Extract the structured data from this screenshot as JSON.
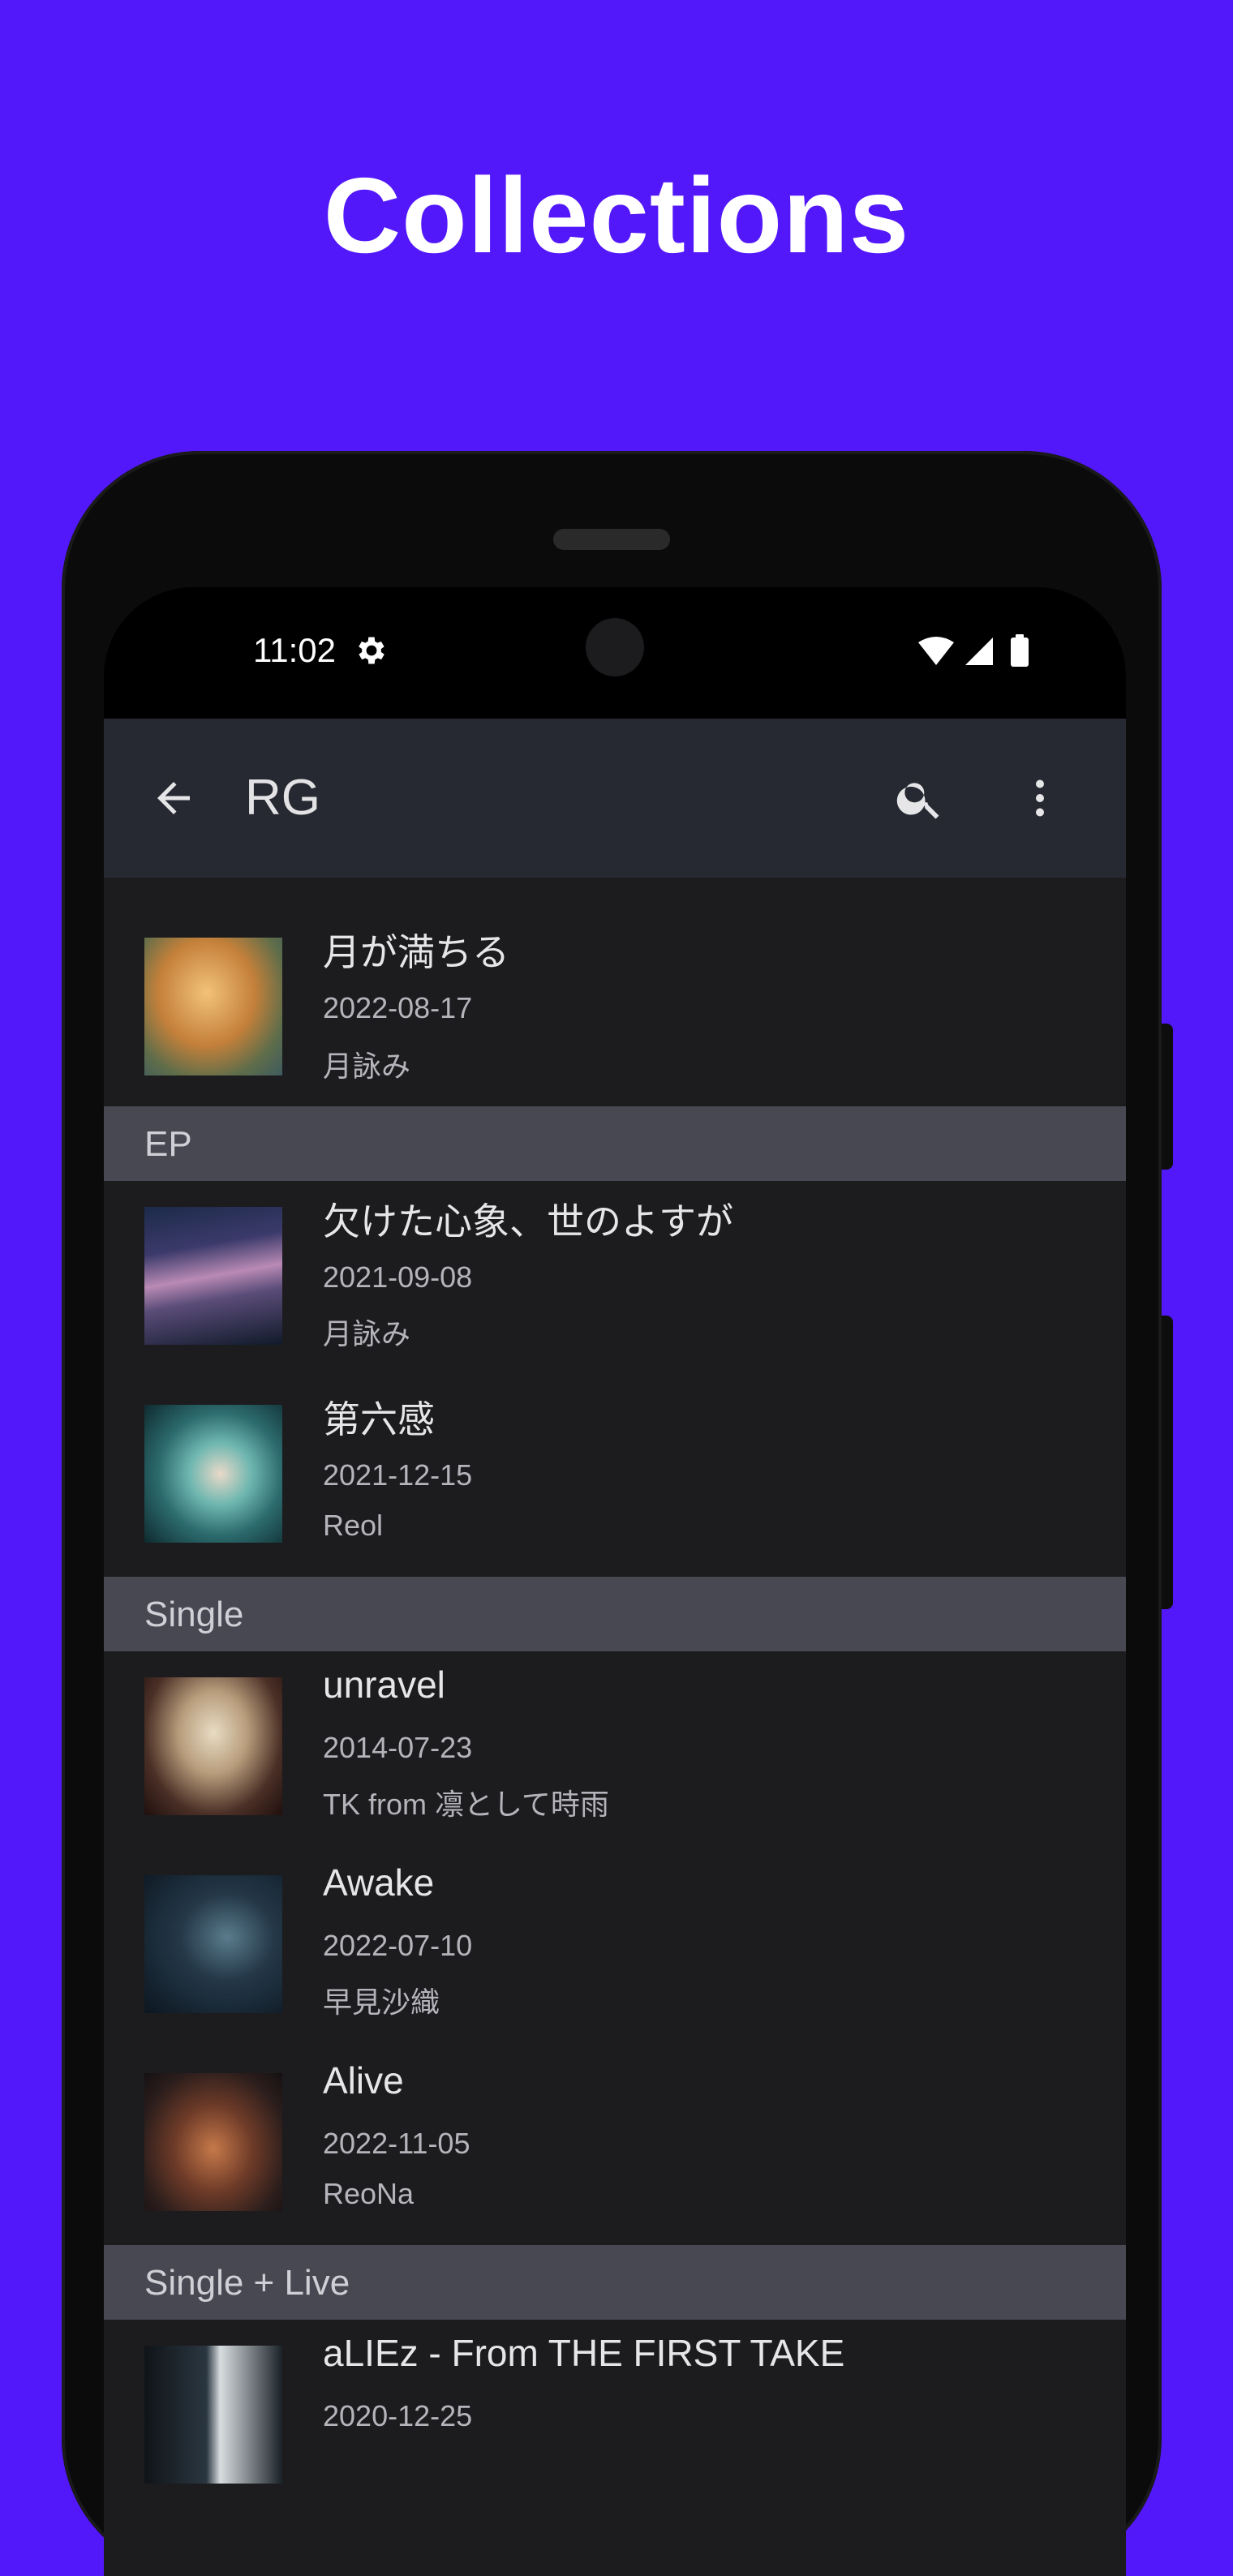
{
  "headline": "Collections",
  "status_bar": {
    "time": "11:02"
  },
  "toolbar": {
    "title": "RG"
  },
  "items": [
    {
      "title": "月が満ちる",
      "date": "2022-08-17",
      "artist": "月詠み"
    },
    {
      "title": "欠けた心象、世のよすが",
      "date": "2021-09-08",
      "artist": "月詠み"
    },
    {
      "title": "第六感",
      "date": "2021-12-15",
      "artist": "Reol"
    },
    {
      "title": "unravel",
      "date": "2014-07-23",
      "artist": "TK from 凛として時雨"
    },
    {
      "title": "Awake",
      "date": "2022-07-10",
      "artist": "早見沙織"
    },
    {
      "title": "Alive",
      "date": "2022-11-05",
      "artist": "ReoNa"
    },
    {
      "title": "aLIEz - From THE FIRST TAKE",
      "date": "2020-12-25",
      "artist": ""
    }
  ],
  "sections": {
    "ep": "EP",
    "single": "Single",
    "single_live": "Single + Live"
  },
  "colors": {
    "background": "#5218FA",
    "toolbar": "#272932",
    "list_bg": "#1c1c1f",
    "section_bg": "#474851"
  }
}
